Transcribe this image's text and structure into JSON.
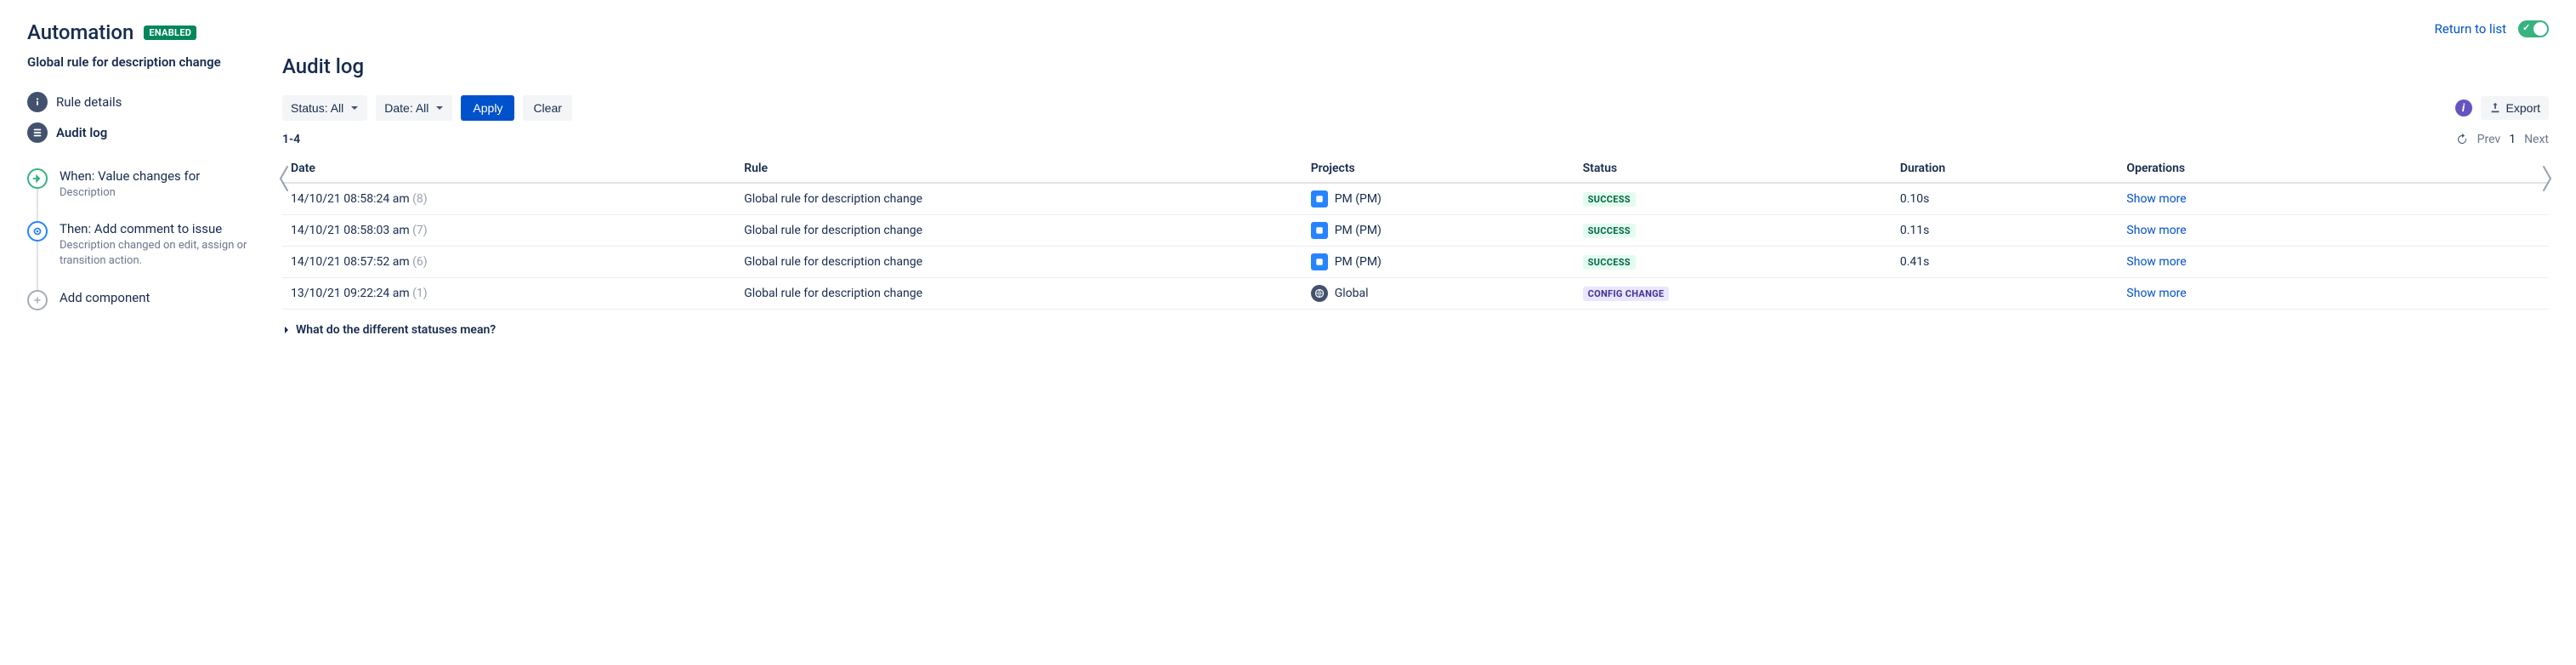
{
  "header": {
    "title": "Automation",
    "enabled_badge": "ENABLED",
    "return_link": "Return to list",
    "rule_name": "Global rule for description change"
  },
  "nav": {
    "rule_details": "Rule details",
    "audit_log": "Audit log"
  },
  "flow": {
    "when_label": "When: Value changes for",
    "when_sub": "Description",
    "then_label": "Then: Add comment to issue",
    "then_sub": "Description changed on edit, assign or transition action.",
    "add_component": "Add component"
  },
  "main": {
    "section_title": "Audit log",
    "filters": {
      "status_label": "Status: All",
      "date_label": "Date: All",
      "apply": "Apply",
      "clear": "Clear"
    },
    "export_label": "Export",
    "range": "1-4",
    "pager": {
      "prev": "Prev",
      "page": "1",
      "next": "Next"
    },
    "columns": {
      "date": "Date",
      "rule": "Rule",
      "projects": "Projects",
      "status": "Status",
      "duration": "Duration",
      "operations": "Operations"
    },
    "rows": [
      {
        "date": "14/10/21 08:58:24 am",
        "count": "(8)",
        "rule": "Global rule for description change",
        "project": "PM (PM)",
        "project_kind": "pm",
        "status": "SUCCESS",
        "status_kind": "success",
        "duration": "0.10s",
        "op": "Show more"
      },
      {
        "date": "14/10/21 08:58:03 am",
        "count": "(7)",
        "rule": "Global rule for description change",
        "project": "PM (PM)",
        "project_kind": "pm",
        "status": "SUCCESS",
        "status_kind": "success",
        "duration": "0.11s",
        "op": "Show more"
      },
      {
        "date": "14/10/21 08:57:52 am",
        "count": "(6)",
        "rule": "Global rule for description change",
        "project": "PM (PM)",
        "project_kind": "pm",
        "status": "SUCCESS",
        "status_kind": "success",
        "duration": "0.41s",
        "op": "Show more"
      },
      {
        "date": "13/10/21 09:22:24 am",
        "count": "(1)",
        "rule": "Global rule for description change",
        "project": "Global",
        "project_kind": "global",
        "status": "CONFIG CHANGE",
        "status_kind": "config",
        "duration": "",
        "op": "Show more"
      }
    ],
    "help_text": "What do the different statuses mean?"
  }
}
